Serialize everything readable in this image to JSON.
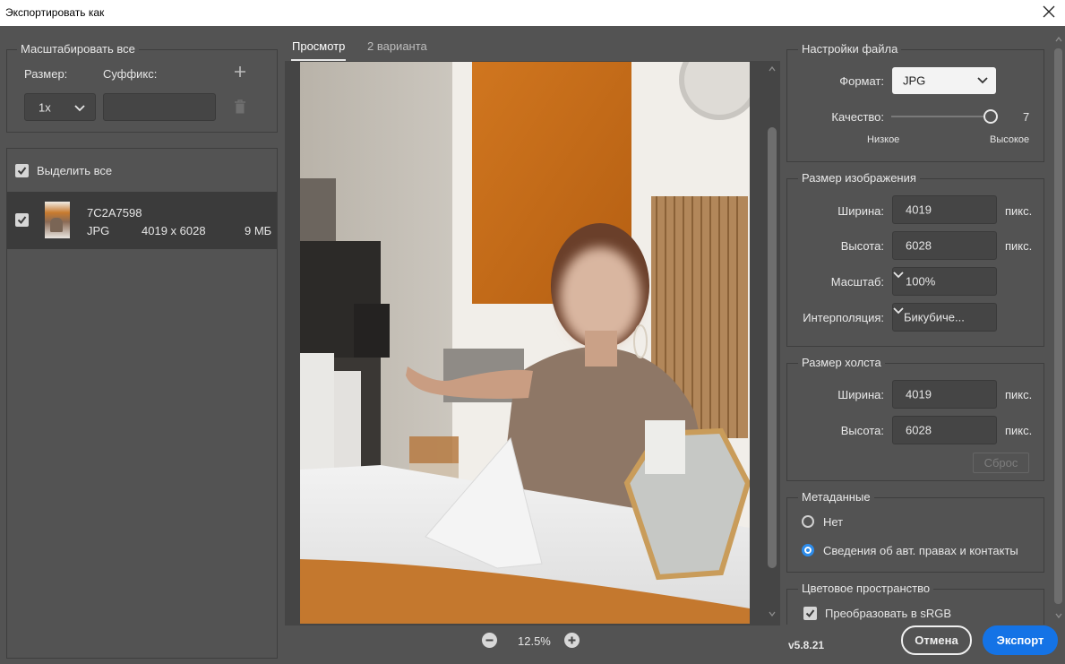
{
  "window": {
    "title": "Экспортировать как"
  },
  "scale_all": {
    "legend": "Масштабировать все",
    "size_label": "Размер:",
    "suffix_label": "Суффикс:",
    "size_value": "1x",
    "suffix_value": ""
  },
  "asset_list": {
    "select_all_label": "Выделить все",
    "select_all_checked": true,
    "items": [
      {
        "name": "7C2A7598",
        "format": "JPG",
        "dimensions": "4019 x 6028",
        "size": "9 МБ",
        "checked": true
      }
    ]
  },
  "preview": {
    "tabs": [
      {
        "label": "Просмотр",
        "active": true
      },
      {
        "label": "2 варианта",
        "active": false
      }
    ],
    "zoom": "12.5%"
  },
  "file_settings": {
    "legend": "Настройки файла",
    "format_label": "Формат:",
    "format_value": "JPG",
    "quality_label": "Качество:",
    "quality_value": "7",
    "quality_low": "Низкое",
    "quality_high": "Высокое",
    "quality_fraction": 1.0
  },
  "image_size": {
    "legend": "Размер изображения",
    "width_label": "Ширина:",
    "width_value": "4019",
    "height_label": "Высота:",
    "height_value": "6028",
    "scale_label": "Масштаб:",
    "scale_value": "100%",
    "interp_label": "Интерполяция:",
    "interp_value": "Бикубиче...",
    "unit": "пикс."
  },
  "canvas_size": {
    "legend": "Размер холста",
    "width_label": "Ширина:",
    "width_value": "4019",
    "height_label": "Высота:",
    "height_value": "6028",
    "unit": "пикс.",
    "reset_label": "Сброс"
  },
  "metadata": {
    "legend": "Метаданные",
    "options": [
      {
        "label": "Нет",
        "selected": false
      },
      {
        "label": "Сведения об авт. правах и контакты",
        "selected": true
      }
    ]
  },
  "color_space": {
    "legend": "Цветовое пространство",
    "convert_label": "Преобразовать в sRGB",
    "convert_checked": true
  },
  "footer": {
    "version": "v5.8.21",
    "cancel_label": "Отмена",
    "export_label": "Экспорт"
  },
  "colors": {
    "accent": "#1473e6",
    "panel_bg": "#535353",
    "field_bg": "#454545"
  }
}
